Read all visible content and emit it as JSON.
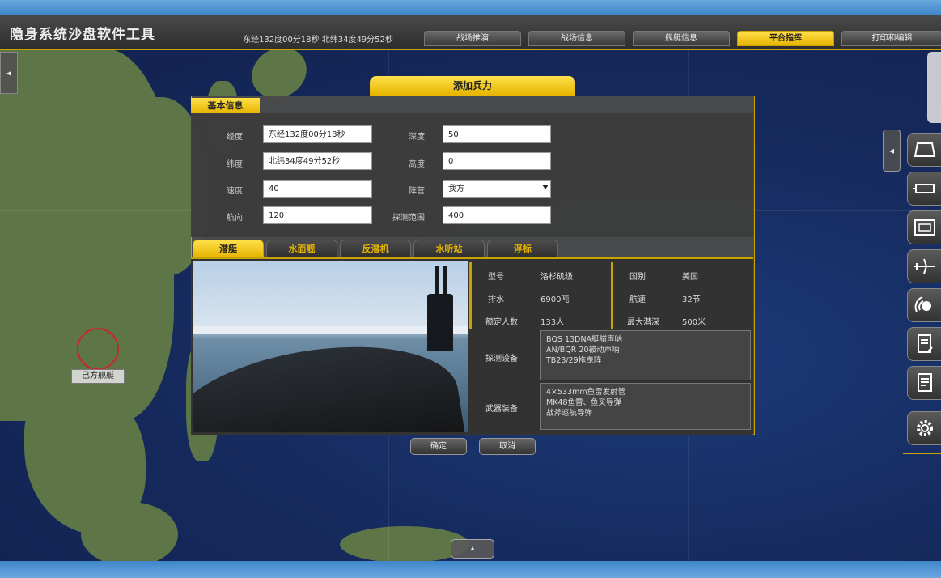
{
  "app": {
    "title": "隐身系统沙盘软件工具"
  },
  "clock": {
    "text": "东经132度00分18秒  北纬34度49分52秒"
  },
  "top_tabs": [
    {
      "label": "战场推演"
    },
    {
      "label": "战场信息"
    },
    {
      "label": "舰艇信息"
    },
    {
      "label": "平台指挥"
    },
    {
      "label": "打印和编辑"
    }
  ],
  "map": {
    "pin_label": "己方舰艇"
  },
  "dialog": {
    "title": "添加兵力",
    "section": "基本信息",
    "fields": {
      "lon_label": "经度",
      "lon_value": "东经132度00分18秒",
      "lat_label": "纬度",
      "lat_value": "北纬34度49分52秒",
      "speed_label": "速度",
      "speed_value": "40",
      "course_label": "航向",
      "course_value": "120",
      "depth_label": "深度",
      "depth_value": "50",
      "height_label": "高度",
      "height_value": "0",
      "side_label": "阵营",
      "side_value": "我方",
      "sensor_label": "探测范围",
      "sensor_value": "400"
    },
    "sub_tabs": [
      {
        "label": "潜艇"
      },
      {
        "label": "水面舰"
      },
      {
        "label": "反潜机"
      },
      {
        "label": "水听站"
      },
      {
        "label": "浮标"
      }
    ],
    "info": {
      "type_label": "型号",
      "type_value": "洛杉矶级",
      "country_label": "国别",
      "country_value": "美国",
      "tonnage_label": "排水",
      "tonnage_value": "6900吨",
      "speed_label": "航速",
      "speed_value": "32节",
      "crew_label": "额定人数",
      "crew_value": "133人",
      "maxdepth_label": "最大潜深",
      "maxdepth_value": "500米",
      "sonar_label": "探测设备",
      "sonar_lines": [
        "BQS 13DNA艇艏声呐",
        "AN/BQR 20被动声呐",
        "TB23/29拖曳阵"
      ],
      "weapon_label": "武器装备",
      "weapon_lines": [
        "4×533mm鱼雷发射管",
        "MK48鱼雷、鱼叉导弹",
        "战斧巡航导弹"
      ]
    },
    "buttons": {
      "ok": "确定",
      "cancel": "取消"
    }
  },
  "colors": {
    "accent": "#e7b400",
    "title_bar": "#3a3a3a",
    "sea": "#15295c",
    "land": "#5e7548",
    "marker": "#c62828"
  },
  "icons": [
    "chevron-left-icon",
    "ship-outline-icon",
    "ruler-icon",
    "radar-panel-icon",
    "aircraft-icon",
    "sonar-icon",
    "report-edit-icon",
    "document-icon",
    "gear-icon"
  ]
}
